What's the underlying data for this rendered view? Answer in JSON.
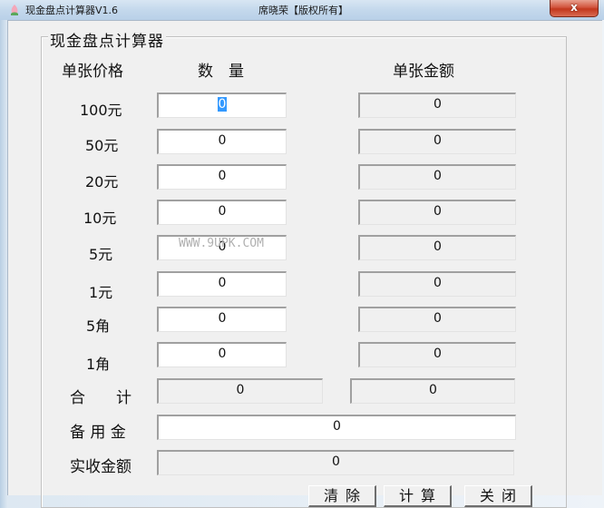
{
  "window": {
    "title": "现金盘点计算器V1.6",
    "subtitle": "席晓荣【版权所有】",
    "close_label": "x"
  },
  "group": {
    "legend": "现金盘点计算器"
  },
  "headers": {
    "denomination": "单张价格",
    "quantity": "数　量",
    "amount": "单张金额"
  },
  "rows": [
    {
      "label": "100元",
      "quantity": "0",
      "amount": "0"
    },
    {
      "label": "50元",
      "quantity": "0",
      "amount": "0"
    },
    {
      "label": "20元",
      "quantity": "0",
      "amount": "0"
    },
    {
      "label": "10元",
      "quantity": "0",
      "amount": "0"
    },
    {
      "label": "5元",
      "quantity": "0",
      "amount": "0"
    },
    {
      "label": "1元",
      "quantity": "0",
      "amount": "0"
    },
    {
      "label": "5角",
      "quantity": "0",
      "amount": "0"
    },
    {
      "label": "1角",
      "quantity": "0",
      "amount": "0"
    }
  ],
  "total": {
    "label": "合　　计",
    "quantity": "0",
    "amount": "0"
  },
  "reserve": {
    "label": "备 用 金",
    "value": "0"
  },
  "received": {
    "label": "实收金额",
    "value": "0"
  },
  "watermark": "WWW.9UPK.COM",
  "buttons": {
    "clear": "清除",
    "calculate": "计算",
    "close": "关闭"
  }
}
